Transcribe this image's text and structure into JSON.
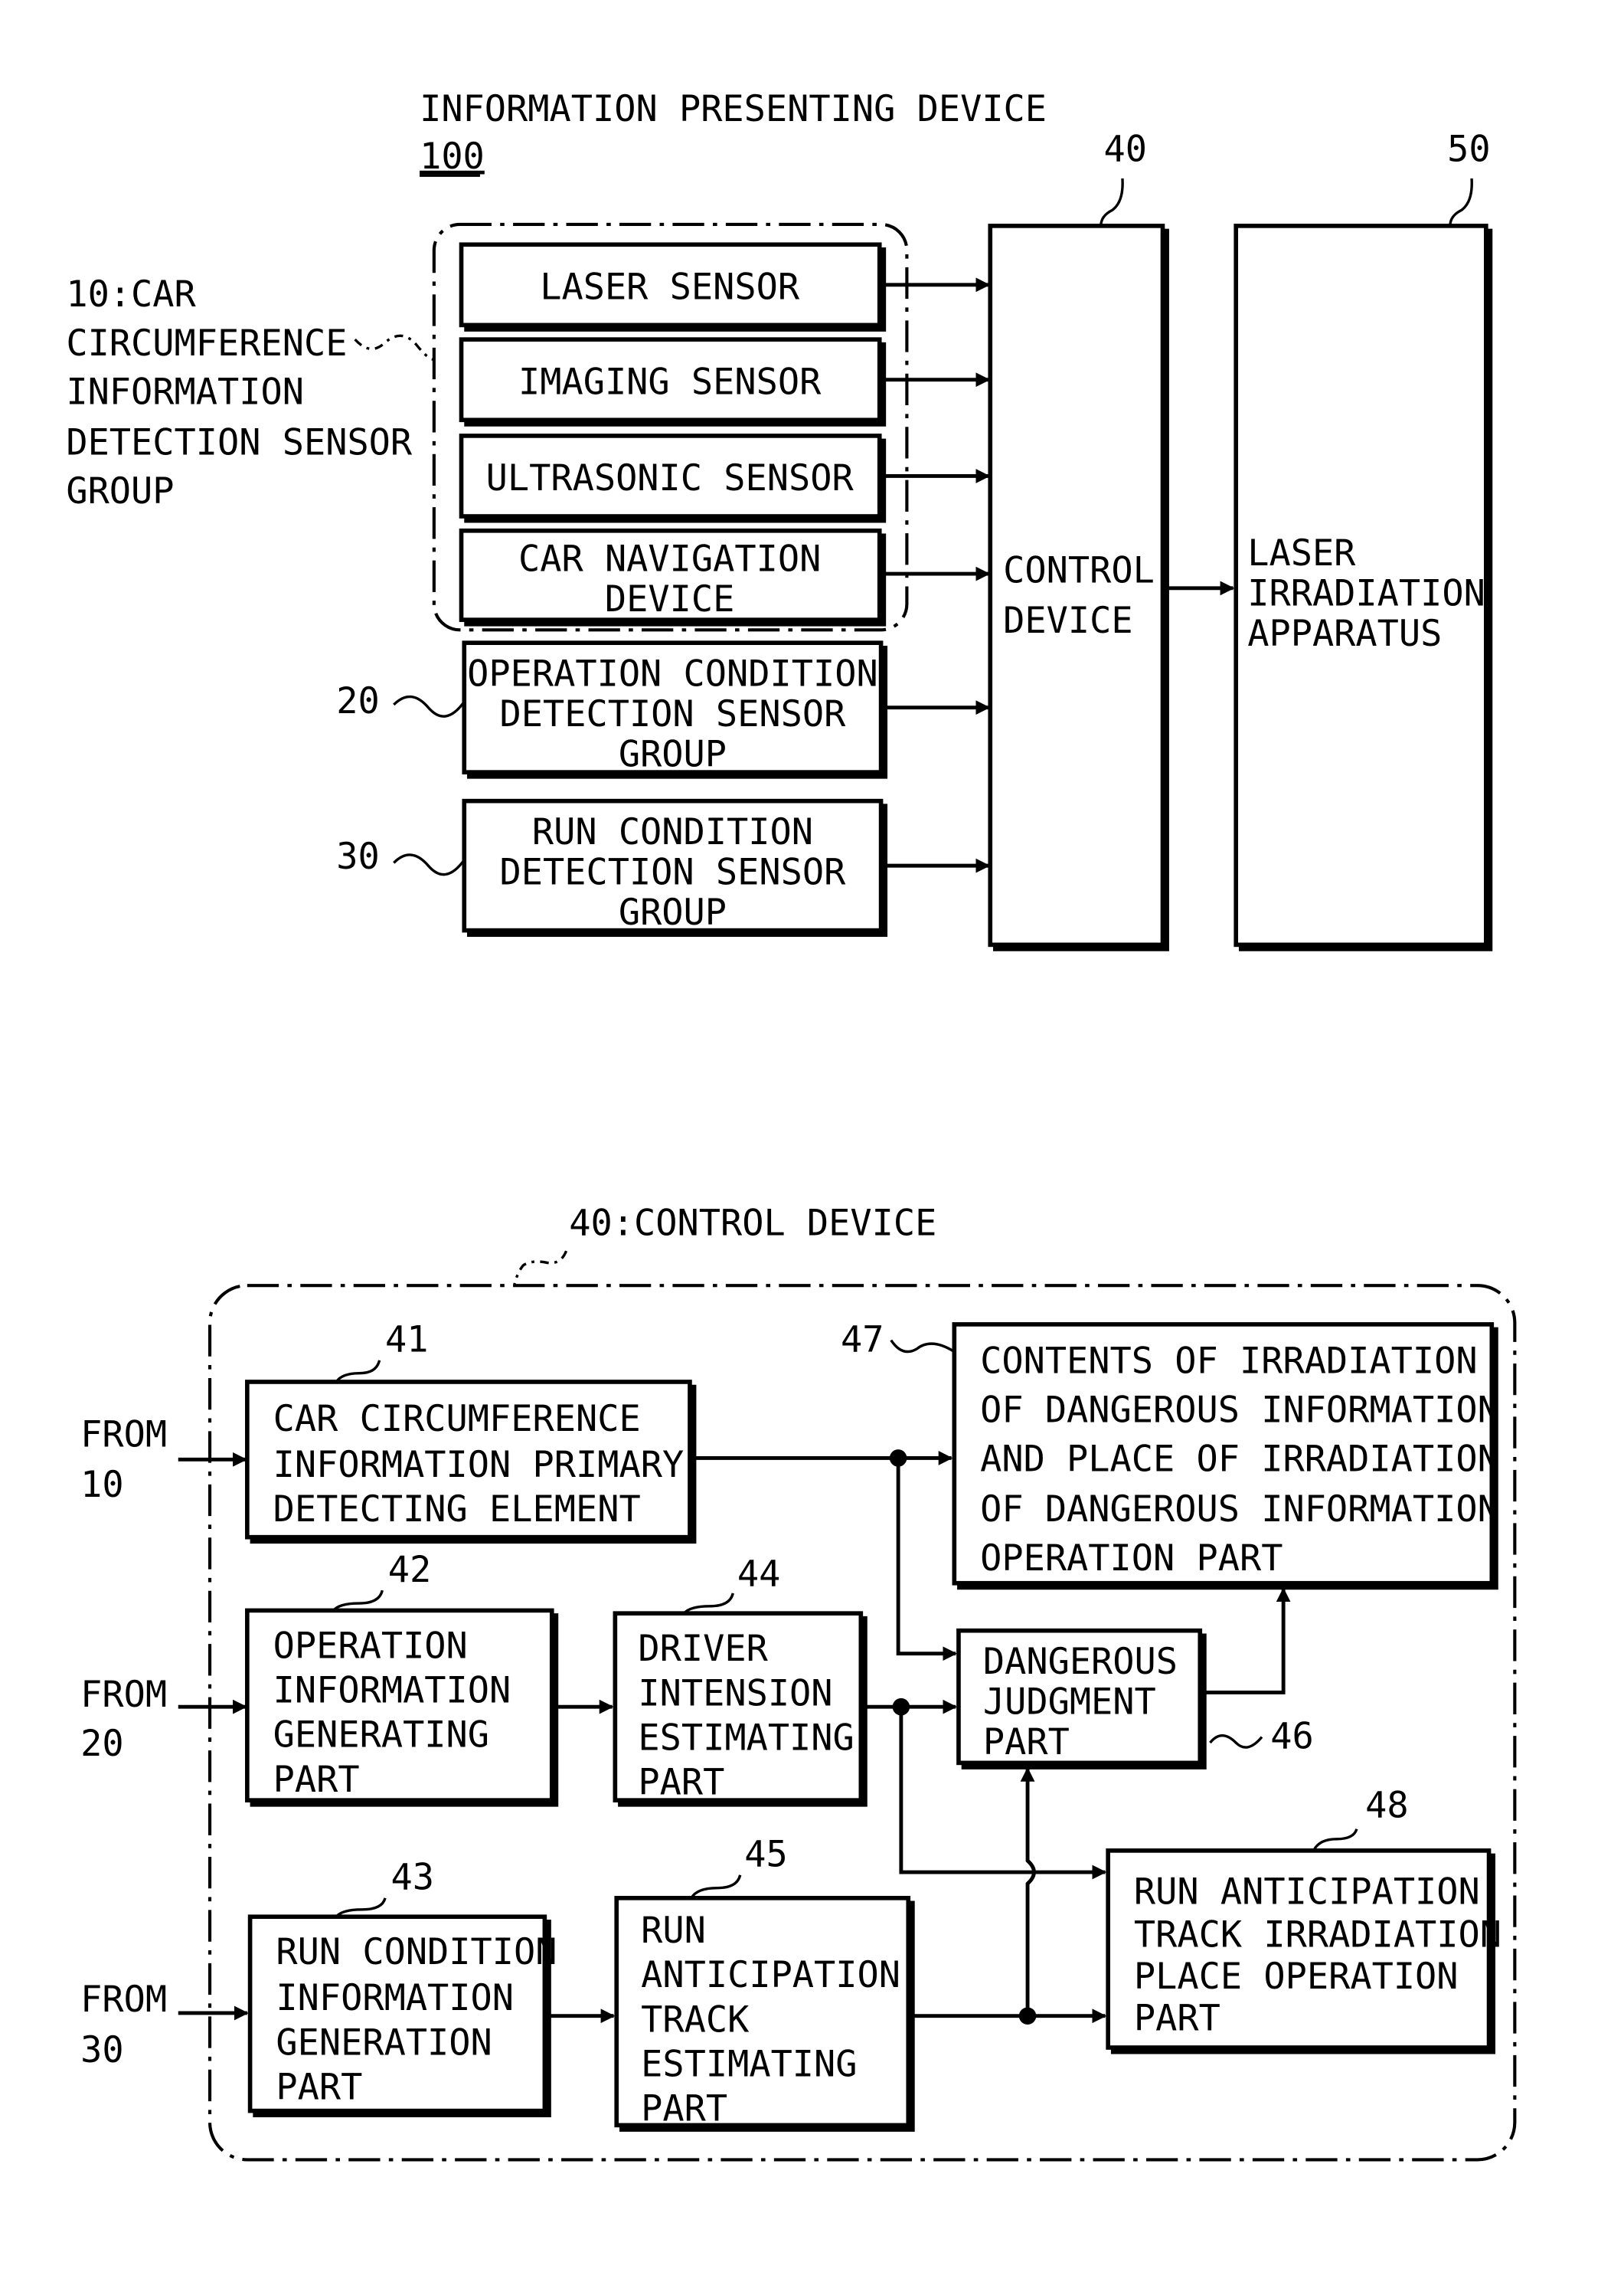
{
  "figure_top": {
    "title": "INFORMATION PRESENTING DEVICE",
    "ref": "100",
    "group10_label": [
      "10:CAR",
      "CIRCUMFERENCE",
      "INFORMATION",
      "DETECTION SENSOR",
      "GROUP"
    ],
    "sensors": [
      {
        "lines": [
          "LASER SENSOR"
        ]
      },
      {
        "lines": [
          "IMAGING SENSOR"
        ]
      },
      {
        "lines": [
          "ULTRASONIC SENSOR"
        ]
      },
      {
        "lines": [
          "CAR NAVIGATION",
          "DEVICE"
        ]
      }
    ],
    "group20": {
      "ref": "20",
      "lines": [
        "OPERATION CONDITION",
        "DETECTION SENSOR",
        "GROUP"
      ]
    },
    "group30": {
      "ref": "30",
      "lines": [
        "RUN CONDITION",
        "DETECTION SENSOR",
        "GROUP"
      ]
    },
    "control": {
      "ref": "40",
      "lines": [
        "CONTROL",
        "DEVICE"
      ]
    },
    "laser": {
      "ref": "50",
      "lines": [
        "LASER",
        "IRRADIATION",
        "APPARATUS"
      ]
    }
  },
  "figure_bottom": {
    "title": "40:CONTROL DEVICE",
    "inputs": [
      {
        "lines": [
          "FROM",
          "10"
        ]
      },
      {
        "lines": [
          "FROM",
          "20"
        ]
      },
      {
        "lines": [
          "FROM",
          "30"
        ]
      }
    ],
    "blocks": {
      "b41": {
        "ref": "41",
        "lines": [
          "CAR CIRCUMFERENCE",
          "INFORMATION PRIMARY",
          "DETECTING ELEMENT"
        ]
      },
      "b42": {
        "ref": "42",
        "lines": [
          "OPERATION",
          "INFORMATION",
          "GENERATING",
          "PART"
        ]
      },
      "b43": {
        "ref": "43",
        "lines": [
          "RUN CONDITION",
          "INFORMATION",
          "GENERATION",
          "PART"
        ]
      },
      "b44": {
        "ref": "44",
        "lines": [
          "DRIVER",
          "INTENSION",
          "ESTIMATING",
          "PART"
        ]
      },
      "b45": {
        "ref": "45",
        "lines": [
          "RUN",
          "ANTICIPATION",
          "TRACK",
          "ESTIMATING",
          "PART"
        ]
      },
      "b46": {
        "ref": "46",
        "lines": [
          "DANGEROUS",
          "JUDGMENT",
          "PART"
        ]
      },
      "b47": {
        "ref": "47",
        "lines": [
          "CONTENTS OF IRRADIATION",
          "OF DANGEROUS INFORMATION",
          "AND PLACE OF IRRADIATION",
          "OF DANGEROUS INFORMATION",
          "OPERATION PART"
        ]
      },
      "b48": {
        "ref": "48",
        "lines": [
          "RUN ANTICIPATION",
          "TRACK IRRADIATION",
          "PLACE OPERATION",
          "PART"
        ]
      }
    }
  }
}
